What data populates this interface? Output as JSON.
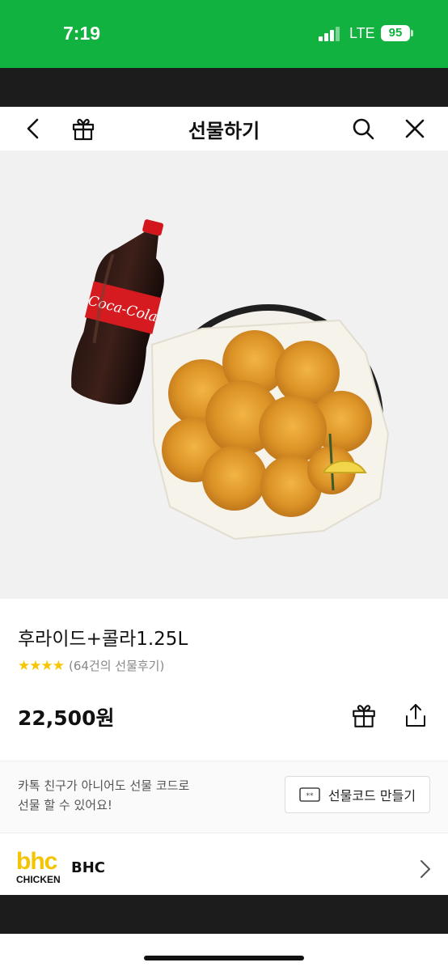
{
  "status_bar": {
    "time": "7:19",
    "network": "LTE",
    "battery": "95"
  },
  "nav": {
    "title": "선물하기",
    "icons": [
      "back-icon",
      "gift-icon",
      "search-icon",
      "close-icon"
    ]
  },
  "product": {
    "name": "후라이드+콜라1.25L",
    "stars": "★★★★",
    "review_count": "(64건의 선물후기)",
    "price": "22,500원",
    "colors": {
      "star": "#f7c600",
      "status_bar": "#11b240"
    }
  },
  "gift_code": {
    "desc_line1": "카톡 친구가 아니어도 선물 코드로",
    "desc_line2": "선물 할 수 있어요!",
    "button_label": "선물코드 만들기"
  },
  "brand": {
    "logo_text": "bhc",
    "logo_sub": "CHICKEN",
    "name": "BHC"
  }
}
